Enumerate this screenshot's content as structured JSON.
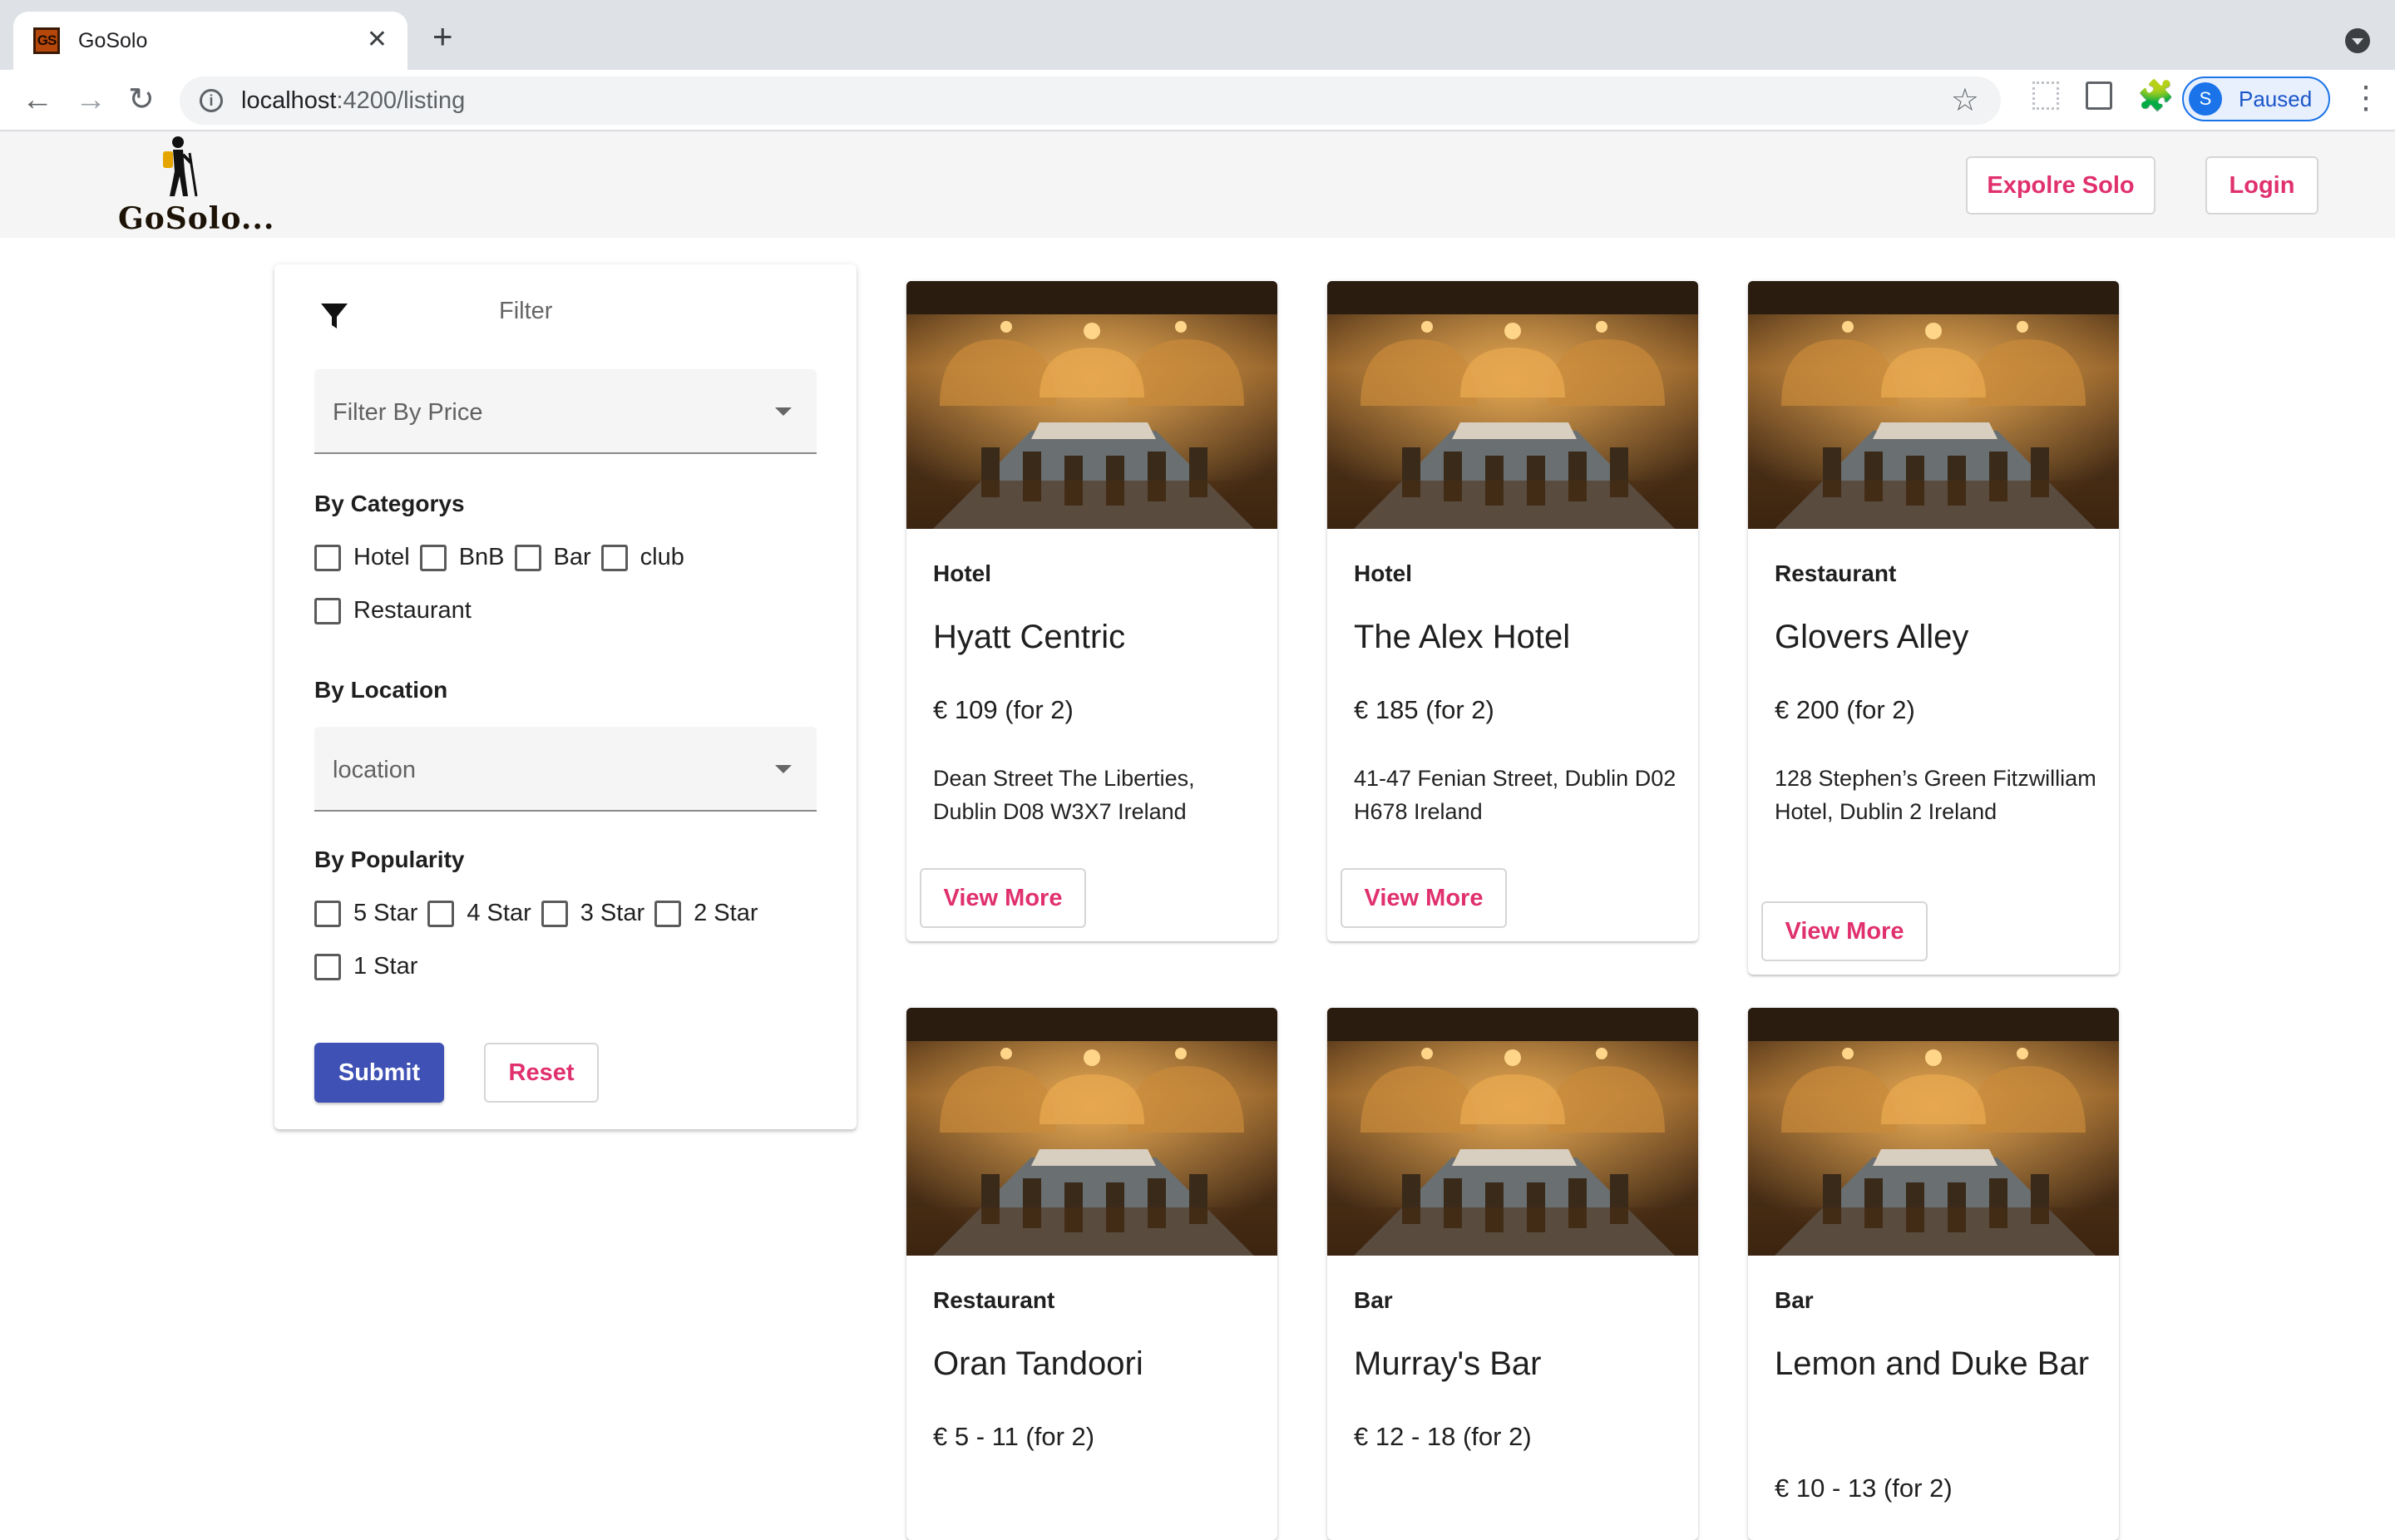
{
  "browser": {
    "tab_favicon_text": "GS",
    "tab_title": "GoSolo",
    "tab_close": "✕",
    "new_tab": "+",
    "url_host": "localhost",
    "url_path": ":4200/listing",
    "profile_initial": "S",
    "profile_status": "Paused",
    "back_glyph": "←",
    "forward_glyph": "→",
    "reload_glyph": "↻",
    "star_glyph": "☆",
    "menu_glyph": "⋮",
    "puzzle_glyph": "🧩",
    "info_glyph": "i",
    "accent_color": "#1a73e8"
  },
  "header": {
    "logo_text": "GoSolo...",
    "explore_label": "Expolre Solo",
    "login_label": "Login",
    "accent_color": "#e0306e"
  },
  "filter": {
    "title": "Filter",
    "price_placeholder": "Filter By Price",
    "categories_heading": "By Categorys",
    "categories": [
      "Hotel",
      "BnB",
      "Bar",
      "club",
      "Restaurant"
    ],
    "location_heading": "By Location",
    "location_placeholder": "location",
    "popularity_heading": "By Popularity",
    "ratings": [
      "5 Star",
      "4 Star",
      "3 Star",
      "2 Star",
      "1 Star"
    ],
    "submit_label": "Submit",
    "reset_label": "Reset",
    "submit_color": "#3f51b5"
  },
  "listings": [
    {
      "category": "Hotel",
      "name": "Hyatt Centric",
      "price": "€ 109 (for 2)",
      "address": "Dean Street The Liberties, Dublin D08 W3X7 Ireland",
      "button": "View More"
    },
    {
      "category": "Hotel",
      "name": "The Alex Hotel",
      "price": "€ 185 (for 2)",
      "address": "41-47 Fenian Street, Dublin D02 H678 Ireland",
      "button": "View More"
    },
    {
      "category": "Restaurant",
      "name": "Glovers Alley",
      "price": "€ 200 (for 2)",
      "address": "128 Stephen’s Green Fitzwilliam Hotel, Dublin 2 Ireland",
      "button": "View More"
    },
    {
      "category": "Restaurant",
      "name": "Oran Tandoori",
      "price": "€ 5 - 11 (for 2)",
      "address": "",
      "button": ""
    },
    {
      "category": "Bar",
      "name": "Murray's Bar",
      "price": "€ 12 - 18 (for 2)",
      "address": "",
      "button": ""
    },
    {
      "category": "Bar",
      "name": "Lemon and Duke Bar",
      "price": "€ 10 - 13 (for 2)",
      "address": "",
      "button": ""
    }
  ]
}
